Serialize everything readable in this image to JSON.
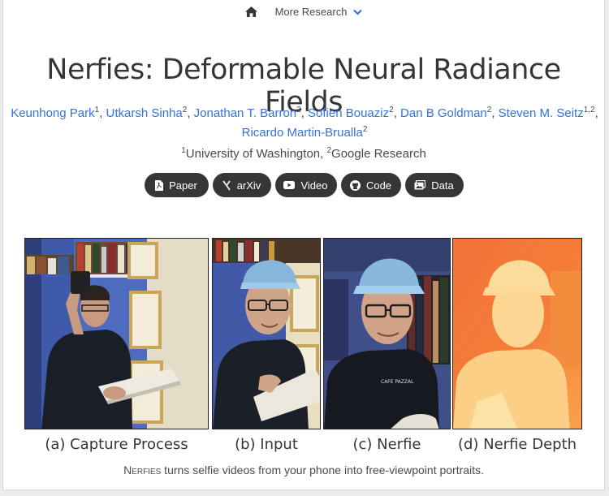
{
  "navbar": {
    "home_icon": "home-icon",
    "more_label": "More Research",
    "more_icon": "chevron-down-icon"
  },
  "title": "Nerfies: Deformable Neural Radiance Fields",
  "authors": [
    {
      "name": "Keunhong Park",
      "sup": "1"
    },
    {
      "name": "Utkarsh Sinha",
      "sup": "2"
    },
    {
      "name": "Jonathan T. Barron",
      "sup": "2"
    },
    {
      "name": "Sofien Bouaziz",
      "sup": "2"
    },
    {
      "name": "Dan B Goldman",
      "sup": "2"
    },
    {
      "name": "Steven M. Seitz",
      "sup": "1,2"
    },
    {
      "name": "Ricardo Martin-Brualla",
      "sup": "2"
    }
  ],
  "affiliations": {
    "a1_sup": "1",
    "a1_name": "University of Washington",
    "a2_sup": "2",
    "a2_name": "Google Research"
  },
  "links": [
    {
      "label": "Paper",
      "icon": "pdf-icon"
    },
    {
      "label": "arXiv",
      "icon": "arxiv-icon"
    },
    {
      "label": "Video",
      "icon": "youtube-icon"
    },
    {
      "label": "Code",
      "icon": "github-icon"
    },
    {
      "label": "Data",
      "icon": "images-icon"
    }
  ],
  "figure": {
    "captions": [
      "(a) Capture Process",
      "(b) Input",
      "(c) Nerfie",
      "(d) Nerfie Depth"
    ]
  },
  "subtitle": {
    "brand": "Nerfies",
    "text": " turns selfie videos from your phone into free-viewpoint portraits."
  },
  "colors": {
    "link": "#3273dc",
    "button_bg": "#363636",
    "text": "#363636"
  }
}
